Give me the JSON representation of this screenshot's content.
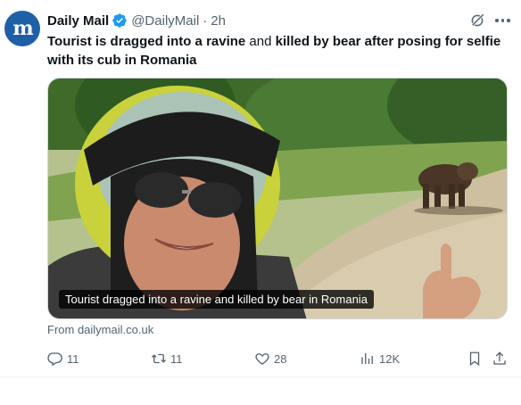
{
  "author": {
    "avatar_text": "m",
    "display_name": "Daily Mail",
    "handle": "@DailyMail",
    "separator": "·",
    "time": "2h"
  },
  "tweet": {
    "text_part1": "Tourist is dragged into a ravine",
    "text_part2": " and ",
    "text_part3": "killed by bear after posing for selfie with its cub in Romania"
  },
  "media": {
    "caption": "Tourist dragged into a ravine and killed by bear in Romania"
  },
  "link_source": "From dailymail.co.uk",
  "actions": {
    "replies": "11",
    "reposts": "11",
    "likes": "28",
    "views": "12K"
  },
  "colors": {
    "accent": "#1d9bf0",
    "avatar_bg": "#1f5fa8",
    "muted": "#536471"
  }
}
